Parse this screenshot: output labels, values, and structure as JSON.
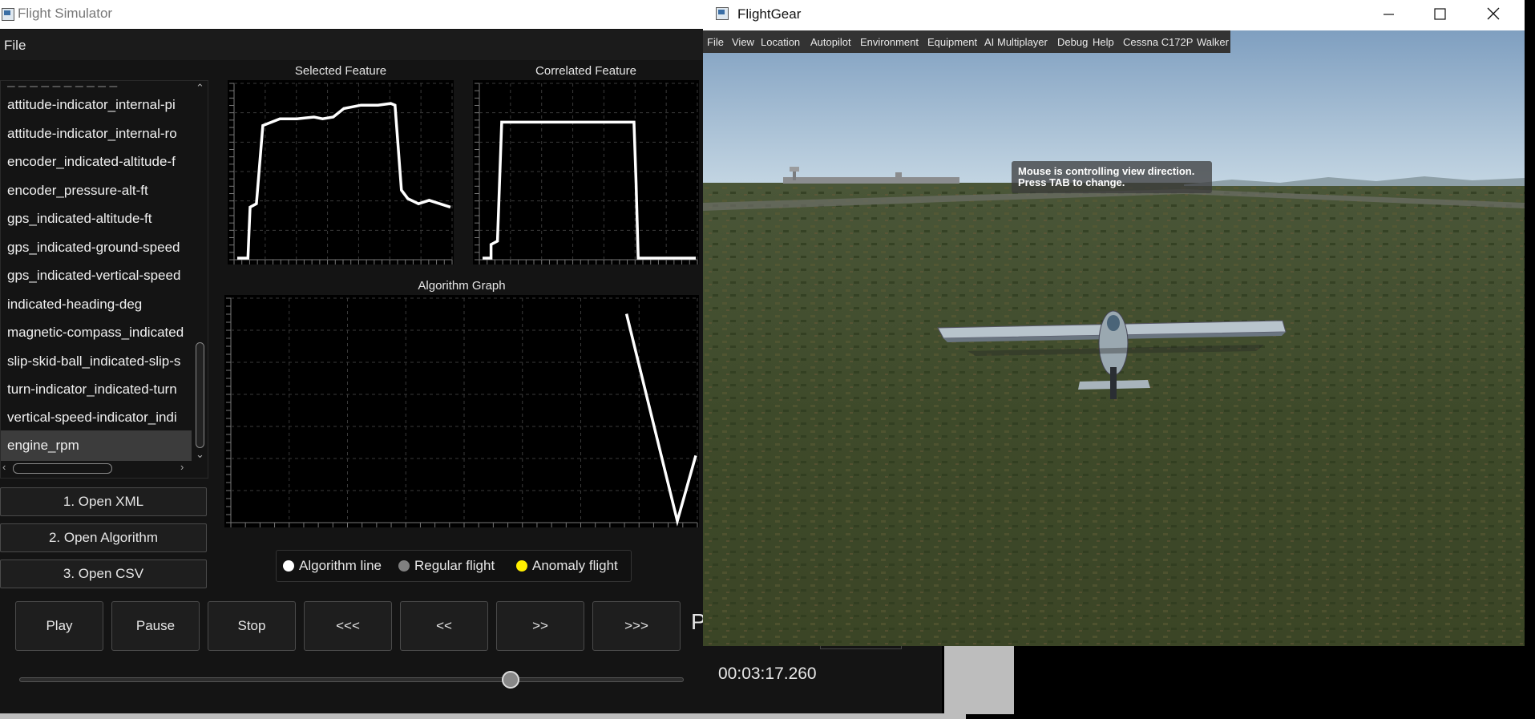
{
  "sim": {
    "title": "Flight Simulator",
    "menu": {
      "file": "File"
    },
    "features": [
      "attitude-indicator_internal-pi",
      "attitude-indicator_internal-ro",
      "encoder_indicated-altitude-f",
      "encoder_pressure-alt-ft",
      "gps_indicated-altitude-ft",
      "gps_indicated-ground-speed",
      "gps_indicated-vertical-speed",
      "indicated-heading-deg",
      "magnetic-compass_indicated",
      "slip-skid-ball_indicated-slip-s",
      "turn-indicator_indicated-turn",
      "vertical-speed-indicator_indi",
      "engine_rpm"
    ],
    "selected_feature": "engine_rpm",
    "buttons": {
      "open_xml": "1. Open XML",
      "open_algorithm": "2. Open Algorithm",
      "open_csv": "3. Open CSV"
    },
    "controls": [
      "Play",
      "Pause",
      "Stop",
      "<<<",
      "<<",
      ">>",
      ">>>"
    ],
    "partial_label": "P",
    "time": "00:03:17.260",
    "slider_position": 0.74,
    "charts": {
      "selected_title": "Selected Feature",
      "correlated_title": "Correlated Feature",
      "algorithm_title": "Algorithm Graph"
    },
    "legend": {
      "algorithm": "Algorithm line",
      "regular": "Regular flight",
      "anomaly": "Anomaly flight",
      "colors": {
        "algorithm": "#ffffff",
        "regular": "#808080",
        "anomaly": "#ffee00"
      }
    }
  },
  "fg": {
    "title": "FlightGear",
    "menus": [
      "File",
      "View",
      "Location",
      "Autopilot",
      "Environment",
      "Equipment",
      "AI",
      "Multiplayer",
      "Debug",
      "Help",
      "Cessna C172P",
      "Walker"
    ],
    "tooltip_line1": "Mouse is controlling view direction.",
    "tooltip_line2": "Press TAB to change."
  },
  "chart_data": [
    {
      "type": "line",
      "title": "Selected Feature",
      "series": [
        {
          "values": [
            0,
            0,
            30,
            32,
            78,
            82,
            82,
            83,
            82,
            83,
            88,
            90,
            90,
            91,
            90,
            40,
            35,
            32,
            34,
            32,
            30
          ]
        }
      ]
    },
    {
      "type": "line",
      "title": "Correlated Feature",
      "series": [
        {
          "values": [
            0,
            0,
            8,
            10,
            80,
            80,
            80,
            80,
            80,
            80,
            80,
            80,
            80,
            45,
            0,
            0,
            0
          ]
        }
      ]
    },
    {
      "type": "line",
      "title": "Algorithm Graph",
      "series": [
        {
          "values": [
            95,
            0,
            30
          ]
        }
      ]
    }
  ]
}
